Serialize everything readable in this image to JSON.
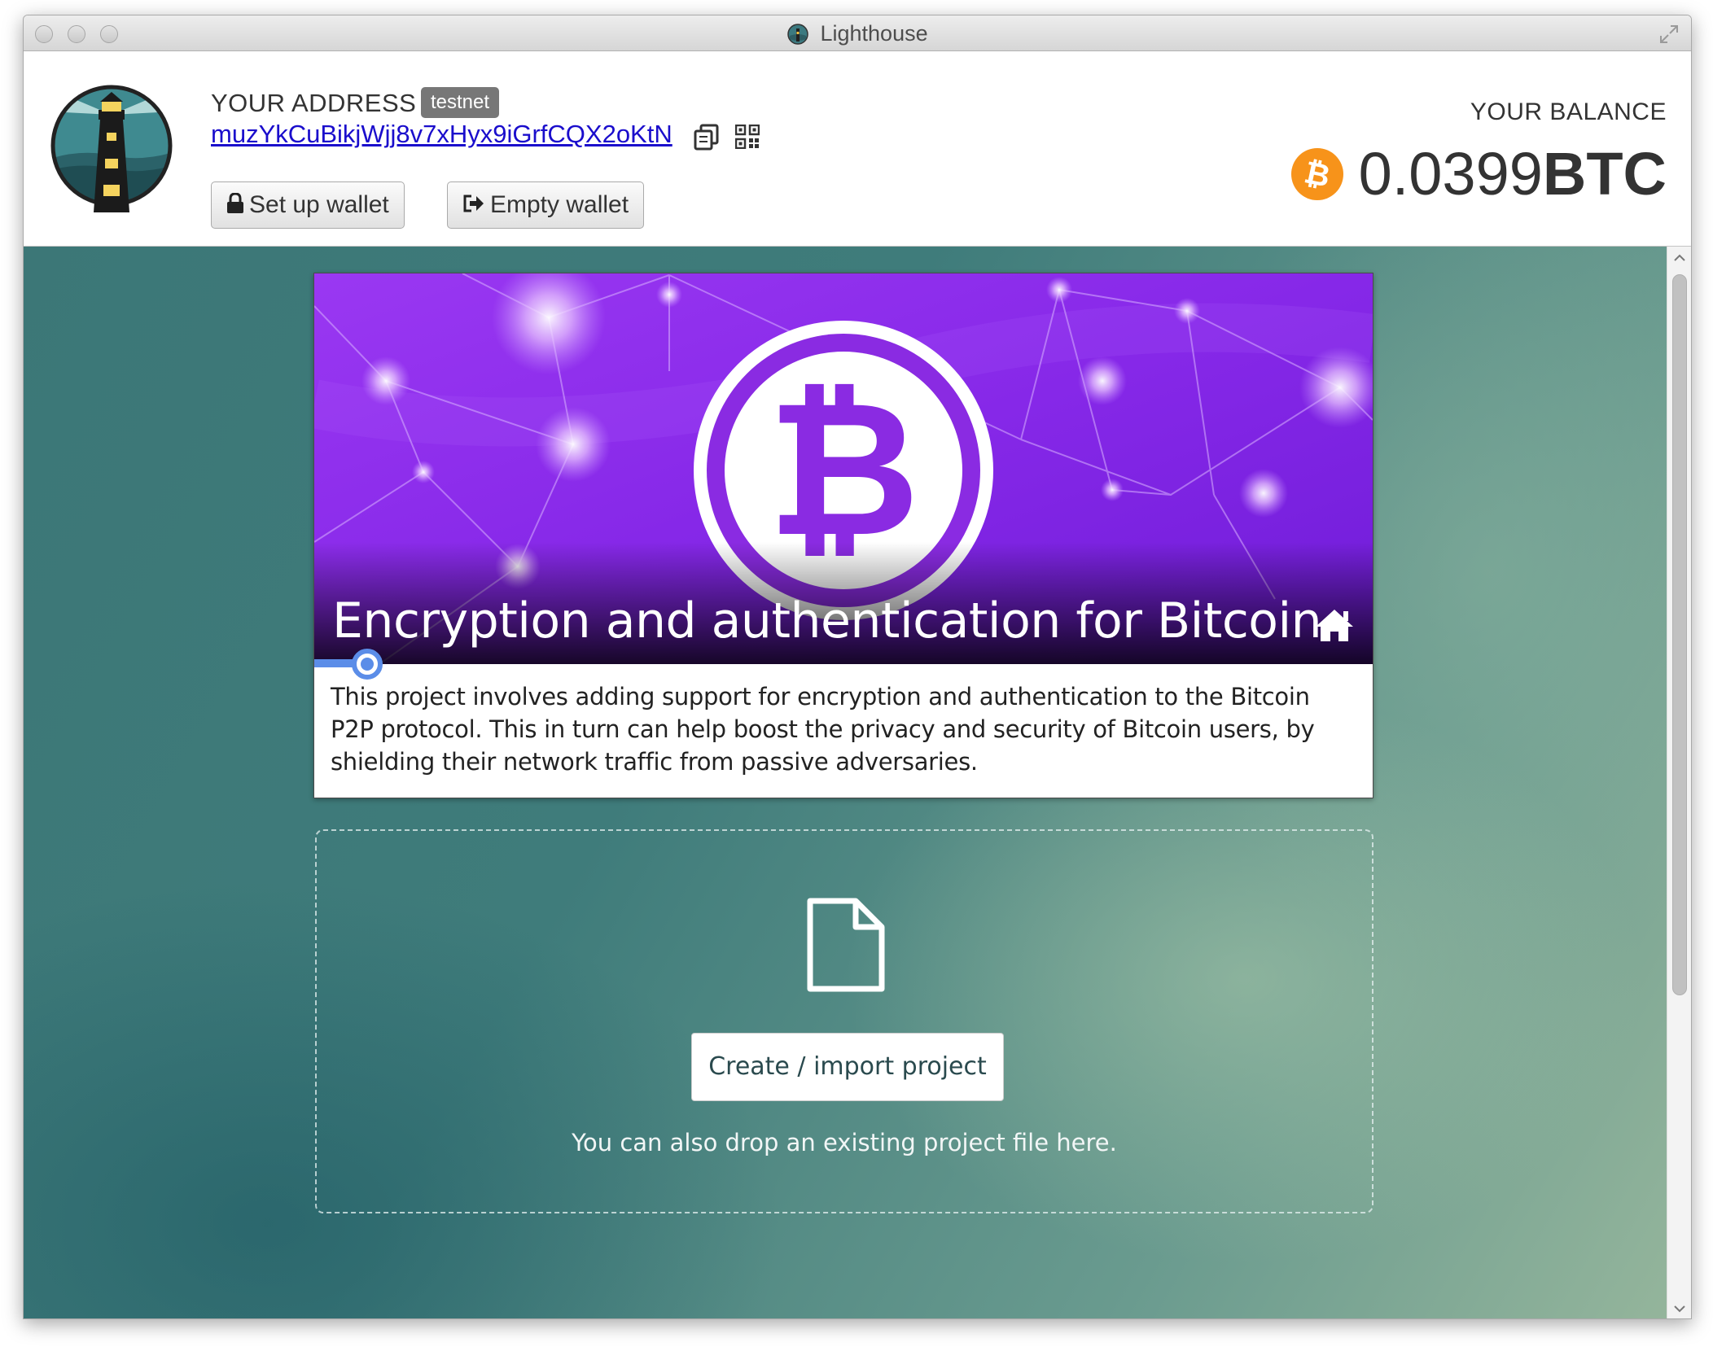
{
  "window": {
    "title": "Lighthouse"
  },
  "header": {
    "address_label": "YOUR ADDRESS",
    "network_badge": "testnet",
    "address": "muzYkCuBikjWjj8v7xHyx9iGrfCQX2oKtN",
    "setup_wallet_label": "Set up wallet",
    "empty_wallet_label": "Empty wallet",
    "balance_label": "YOUR BALANCE",
    "balance_value": "0.0399",
    "balance_unit": "BTC"
  },
  "project": {
    "title": "Encryption and authentication for Bitcoin",
    "description": "This project involves adding support for encryption and authentication to the Bitcoin P2P protocol. This in turn can help boost the privacy and security of Bitcoin users, by shielding their network traffic from passive adversaries.",
    "progress": 0.05
  },
  "dropzone": {
    "create_button_label": "Create / import project",
    "hint": "You can also drop an existing project file here."
  },
  "colors": {
    "accent_blue": "#5b8de8",
    "btc_orange": "#f7931a",
    "banner_purple": "#8a2be2"
  },
  "icons": [
    "app-icon",
    "lighthouse-logo",
    "copy-icon",
    "qr-code-icon",
    "lock-icon",
    "exit-icon",
    "bitcoin-icon",
    "home-icon",
    "file-icon",
    "fullscreen-icon"
  ]
}
